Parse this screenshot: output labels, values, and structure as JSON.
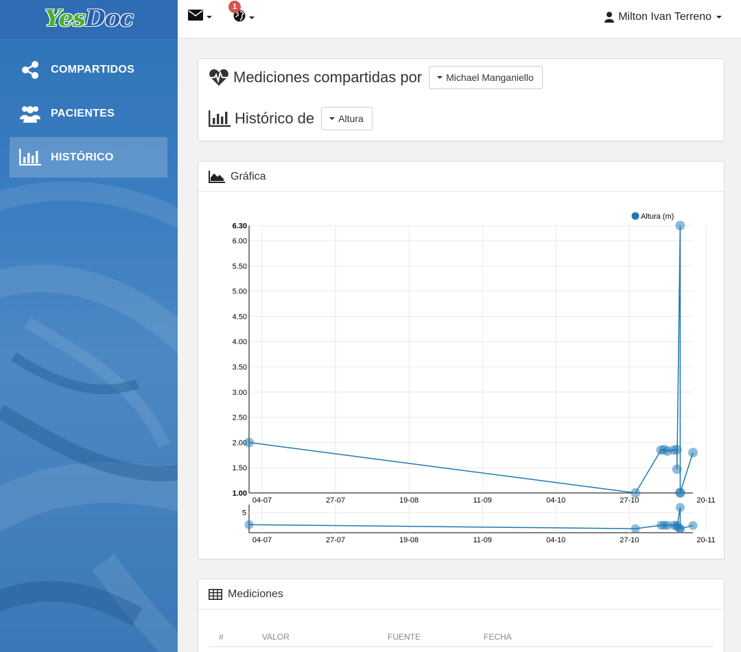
{
  "brand": {
    "name_part1": "Yes",
    "name_part2": "Doc"
  },
  "sidebar": {
    "items": [
      {
        "label": "COMPARTIDOS",
        "icon": "share-icon",
        "active": false
      },
      {
        "label": "PACIENTES",
        "icon": "users-icon",
        "active": false
      },
      {
        "label": "HISTÓRICO",
        "icon": "bar-chart-icon",
        "active": true
      }
    ]
  },
  "topbar": {
    "mail_icon": "envelope-icon",
    "globe_icon": "globe-icon",
    "notification_count": "1",
    "user_name": "Milton Ivan Terreno",
    "user_icon": "user-icon"
  },
  "header_panel": {
    "shared_title": "Mediciones compartidas por",
    "shared_by": "Michael Manganiello",
    "history_title": "Histórico de",
    "history_type": "Altura"
  },
  "chart_panel": {
    "title": "Gráfica"
  },
  "chart_data": {
    "type": "line",
    "legend": [
      "Altura (m)"
    ],
    "legend_position": "top-right",
    "grid": true,
    "x_ticks": [
      "04-07",
      "27-07",
      "19-08",
      "11-09",
      "04-10",
      "27-10",
      "20-11"
    ],
    "y_ticks": [
      "1.00",
      "1.50",
      "2.00",
      "2.50",
      "3.00",
      "3.50",
      "4.00",
      "4.50",
      "5.00",
      "5.50",
      "6.00",
      "6.30"
    ],
    "ylim": [
      1.0,
      6.3
    ],
    "xlim": [
      "2015-07-04",
      "2015-11-20"
    ],
    "series": [
      {
        "name": "Altura (m)",
        "color": "#1f77b4",
        "points": [
          {
            "x": "2015-07-04",
            "y": 2.0
          },
          {
            "x": "2015-11-02",
            "y": 1.0
          },
          {
            "x": "2015-11-10",
            "y": 1.85
          },
          {
            "x": "2015-11-11",
            "y": 1.86
          },
          {
            "x": "2015-11-12",
            "y": 1.83
          },
          {
            "x": "2015-11-14",
            "y": 1.85
          },
          {
            "x": "2015-11-15",
            "y": 1.86
          },
          {
            "x": "2015-11-15",
            "y": 1.47
          },
          {
            "x": "2015-11-16",
            "y": 6.3
          },
          {
            "x": "2015-11-16",
            "y": 1.0
          },
          {
            "x": "2015-11-16",
            "y": 1.01
          },
          {
            "x": "2015-11-20",
            "y": 1.8
          }
        ]
      }
    ],
    "overview": {
      "y_ticks": [
        "5"
      ],
      "ylim": [
        0,
        7
      ]
    }
  },
  "table_panel": {
    "title": "Mediciones",
    "columns": [
      "#",
      "VALOR",
      "FUENTE",
      "FECHA"
    ]
  }
}
